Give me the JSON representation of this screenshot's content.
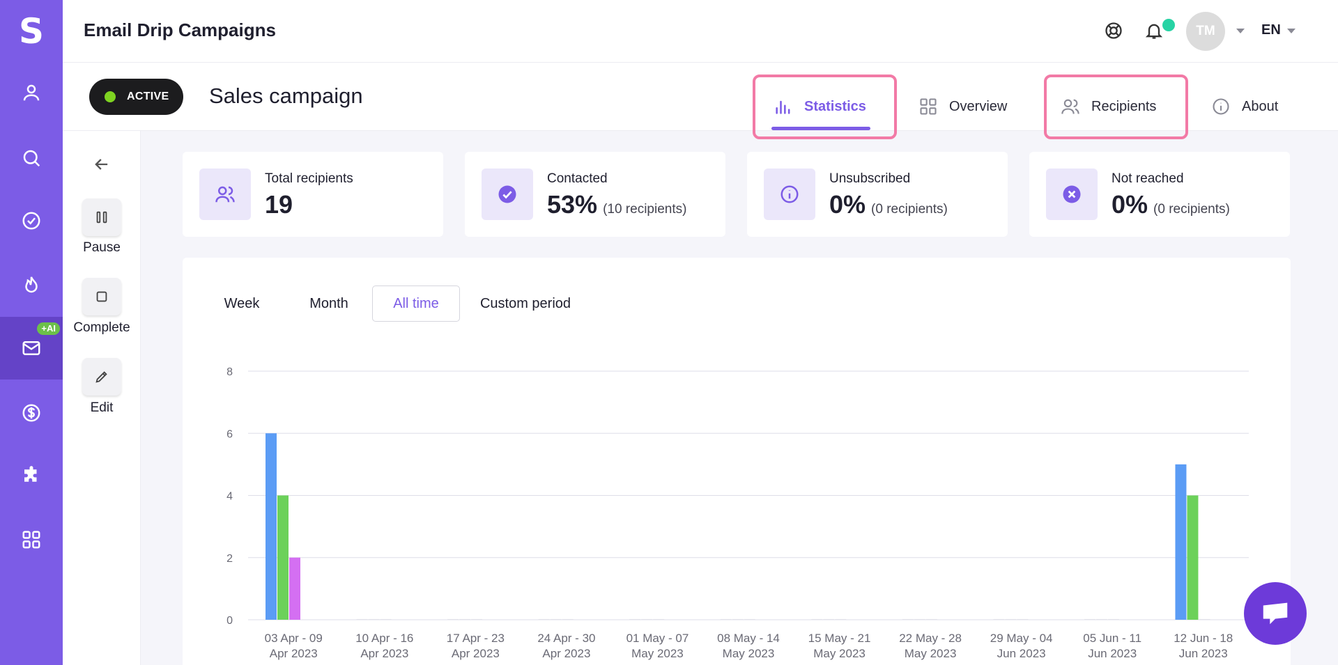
{
  "app": {
    "logo": "S",
    "title": "Email Drip Campaigns",
    "language": "EN",
    "avatar_initials": "TM",
    "ai_badge": "+AI"
  },
  "sidebar": {
    "items": [
      {
        "icon": "user-icon"
      },
      {
        "icon": "search-icon"
      },
      {
        "icon": "check-circle-icon"
      },
      {
        "icon": "fire-icon"
      },
      {
        "icon": "mail-icon",
        "active": true
      },
      {
        "icon": "dollar-icon"
      },
      {
        "icon": "puzzle-icon"
      },
      {
        "icon": "grid-icon"
      }
    ]
  },
  "campaign": {
    "status": "ACTIVE",
    "name": "Sales campaign"
  },
  "tabs": [
    {
      "label": "Statistics",
      "icon": "bar-chart-icon",
      "active": true
    },
    {
      "label": "Overview",
      "icon": "grid-icon"
    },
    {
      "label": "Recipients",
      "icon": "users-icon"
    },
    {
      "label": "About",
      "icon": "info-icon"
    }
  ],
  "actions": {
    "pause": "Pause",
    "complete": "Complete",
    "edit": "Edit"
  },
  "stats": [
    {
      "title": "Total recipients",
      "value": "19",
      "sub": ""
    },
    {
      "title": "Contacted",
      "value": "53%",
      "sub": "(10 recipients)"
    },
    {
      "title": "Unsubscribed",
      "value": "0%",
      "sub": "(0 recipients)"
    },
    {
      "title": "Not reached",
      "value": "0%",
      "sub": "(0 recipients)"
    }
  ],
  "periods": [
    "Week",
    "Month",
    "All time",
    "Custom period"
  ],
  "active_period": "All time",
  "colors": {
    "accent": "#7c5ce6",
    "series_blue": "#5b9cf5",
    "series_green": "#6cd15a",
    "series_purple": "#d46ff2",
    "status_dot": "#7ed321"
  },
  "chart_data": {
    "type": "bar",
    "categories": [
      [
        "03 Apr - 09",
        "Apr 2023"
      ],
      [
        "10 Apr - 16",
        "Apr 2023"
      ],
      [
        "17 Apr - 23",
        "Apr 2023"
      ],
      [
        "24 Apr - 30",
        "Apr 2023"
      ],
      [
        "01 May - 07",
        "May 2023"
      ],
      [
        "08 May - 14",
        "May 2023"
      ],
      [
        "15 May - 21",
        "May 2023"
      ],
      [
        "22 May - 28",
        "May 2023"
      ],
      [
        "29 May - 04",
        "Jun 2023"
      ],
      [
        "05 Jun - 11",
        "Jun 2023"
      ],
      [
        "12 Jun - 18",
        "Jun 2023"
      ]
    ],
    "series": [
      {
        "color": "#5b9cf5",
        "values": [
          6,
          0,
          0,
          0,
          0,
          0,
          0,
          0,
          0,
          0,
          5
        ]
      },
      {
        "color": "#6cd15a",
        "values": [
          4,
          0,
          0,
          0,
          0,
          0,
          0,
          0,
          0,
          0,
          4
        ]
      },
      {
        "color": "#d46ff2",
        "values": [
          2,
          0,
          0,
          0,
          0,
          0,
          0,
          0,
          0,
          0,
          0
        ]
      }
    ],
    "yticks": [
      0,
      2,
      4,
      6,
      8
    ],
    "ylim": [
      0,
      8
    ],
    "grid": true
  }
}
